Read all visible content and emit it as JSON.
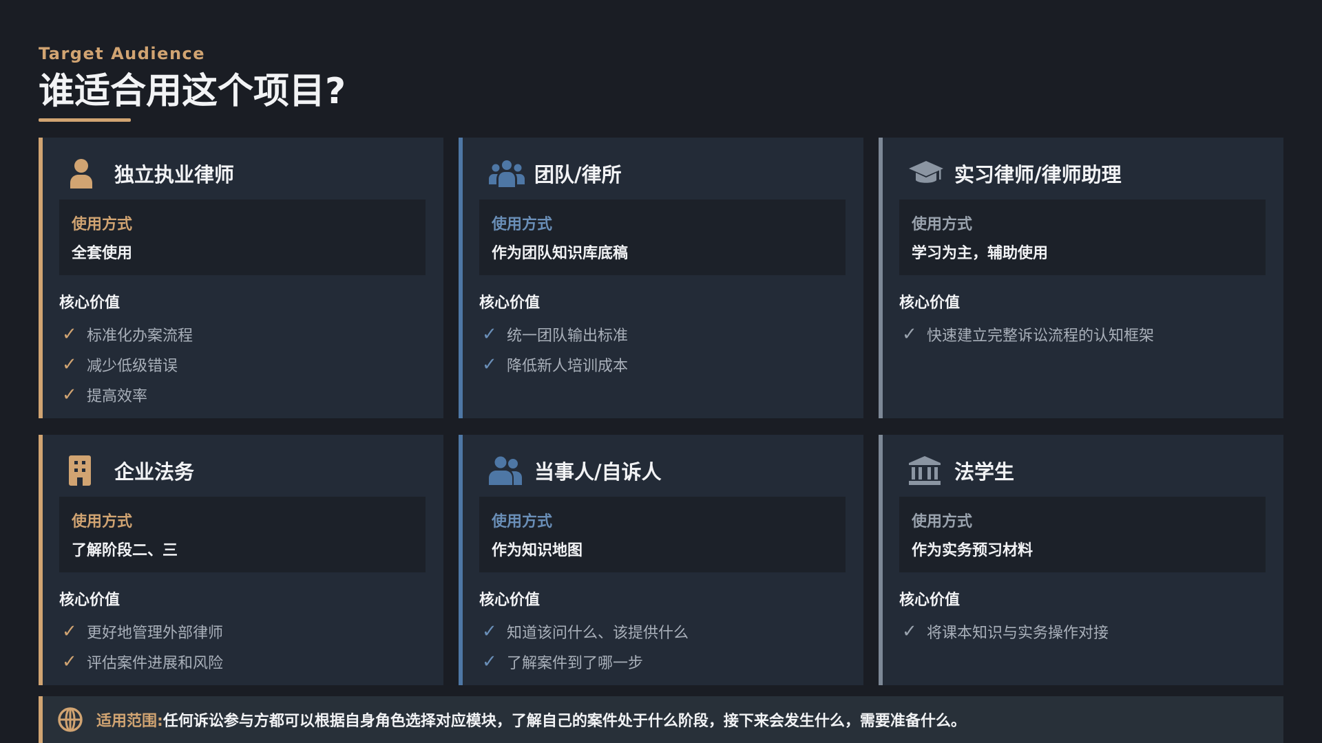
{
  "header": {
    "eyebrow": "Target Audience",
    "title": "谁适合用这个项目?"
  },
  "colors": {
    "gold": "#d1a472",
    "blue": "#4e77a5",
    "gray": "#7d8896",
    "background": "#1a1d24",
    "card": "#232b37"
  },
  "cards": [
    {
      "icon": "person-icon",
      "title": "独立执业律师",
      "usage_label": "使用方式",
      "usage_value": "全套使用",
      "value_label": "核心价值",
      "values": [
        "标准化办案流程",
        "减少低级错误",
        "提高效率"
      ]
    },
    {
      "icon": "group-icon",
      "title": "团队/律所",
      "usage_label": "使用方式",
      "usage_value": "作为团队知识库底稿",
      "value_label": "核心价值",
      "values": [
        "统一团队输出标准",
        "降低新人培训成本"
      ]
    },
    {
      "icon": "graduation-cap-icon",
      "title": "实习律师/律师助理",
      "usage_label": "使用方式",
      "usage_value": "学习为主，辅助使用",
      "value_label": "核心价值",
      "values": [
        "快速建立完整诉讼流程的认知框架"
      ]
    },
    {
      "icon": "building-icon",
      "title": "企业法务",
      "usage_label": "使用方式",
      "usage_value": "了解阶段二、三",
      "value_label": "核心价值",
      "values": [
        "更好地管理外部律师",
        "评估案件进展和风险"
      ]
    },
    {
      "icon": "users-icon",
      "title": "当事人/自诉人",
      "usage_label": "使用方式",
      "usage_value": "作为知识地图",
      "value_label": "核心价值",
      "values": [
        "知道该问什么、该提供什么",
        "了解案件到了哪一步"
      ]
    },
    {
      "icon": "institution-icon",
      "title": "法学生",
      "usage_label": "使用方式",
      "usage_value": "作为实务预习材料",
      "value_label": "核心价值",
      "values": [
        "将课本知识与实务操作对接"
      ]
    }
  ],
  "footer": {
    "icon": "globe-icon",
    "label": "适用范围:",
    "text": "任何诉讼参与方都可以根据自身角色选择对应模块，了解自己的案件处于什么阶段，接下来会发生什么，需要准备什么。"
  }
}
